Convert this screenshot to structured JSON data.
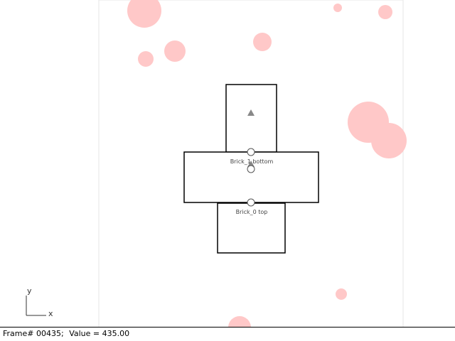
{
  "colors": {
    "background": "#ffffff",
    "frame_border": "#e6e6e6",
    "circle_fill": "#ffc8c8",
    "brick_stroke": "#000000",
    "marker": "#888888"
  },
  "scene": {
    "bricks": [
      {
        "name": "brick-top-narrow"
      },
      {
        "name": "brick-middle-wide"
      },
      {
        "name": "brick-bottom"
      }
    ],
    "labels": {
      "brick1_bottom": "Brick_1 bottom",
      "brick0_top": "Brick_0 top"
    }
  },
  "axes": {
    "x_label": "x",
    "y_label": "y"
  },
  "status": {
    "frame_text": "Frame# 00435;",
    "value_text": "Value = 435.00"
  }
}
